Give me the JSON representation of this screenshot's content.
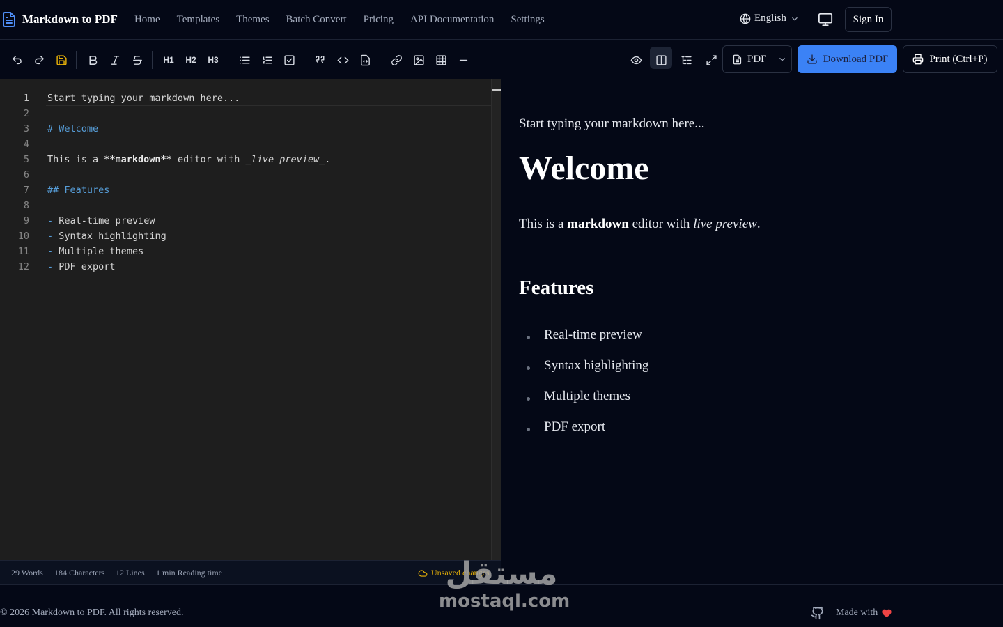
{
  "header": {
    "brand": "Markdown to PDF",
    "nav": [
      "Home",
      "Templates",
      "Themes",
      "Batch Convert",
      "Pricing",
      "API Documentation",
      "Settings"
    ],
    "language": "English",
    "sign_in": "Sign In"
  },
  "toolbar": {
    "format_select": "PDF",
    "download_label": "Download PDF",
    "print_label": "Print (Ctrl+P)",
    "h1": "H1",
    "h2": "H2",
    "h3": "H3",
    "icons": [
      "undo-icon",
      "redo-icon",
      "save-icon",
      "bold-icon",
      "italic-icon",
      "strikethrough-icon",
      "bullet-list-icon",
      "numbered-list-icon",
      "task-list-icon",
      "quote-icon",
      "code-icon",
      "code-block-icon",
      "link-icon",
      "image-icon",
      "table-icon",
      "horizontal-rule-icon",
      "eye-icon",
      "split-view-icon",
      "toc-icon",
      "fullscreen-icon"
    ]
  },
  "editor": {
    "line_numbers": [
      "1",
      "2",
      "3",
      "4",
      "5",
      "6",
      "7",
      "8",
      "9",
      "10",
      "11",
      "12"
    ],
    "l1": "Start typing your markdown here...",
    "l3": "# Welcome",
    "l5a": "This is a ",
    "l5b": "**markdown**",
    "l5c": " editor with ",
    "l5d": "_live preview_",
    "l5e": ".",
    "l7": "## Features",
    "list_dash": "-",
    "items": [
      "Real-time preview",
      "Syntax highlighting",
      "Multiple themes",
      "PDF export"
    ]
  },
  "status": {
    "words": "29 Words",
    "characters": "184 Characters",
    "lines": "12 Lines",
    "reading": "1 min Reading time",
    "unsaved": "Unsaved changes"
  },
  "preview": {
    "intro": "Start typing your markdown here...",
    "h1": "Welcome",
    "para_a": "This is a ",
    "para_b": "markdown",
    "para_c": " editor with ",
    "para_d": "live preview",
    "para_e": ".",
    "h2": "Features",
    "items": [
      "Real-time preview",
      "Syntax highlighting",
      "Multiple themes",
      "PDF export"
    ]
  },
  "footer": {
    "copyright": "© 2026 Markdown to PDF. All rights reserved.",
    "made_with": "Made with"
  },
  "watermark": {
    "arabic": "مستقل",
    "latin": "mostaql.com"
  },
  "colors": {
    "accent": "#3b82f6",
    "warning": "#eab308",
    "heart": "#ef4444",
    "md_heading": "#569cd6"
  }
}
